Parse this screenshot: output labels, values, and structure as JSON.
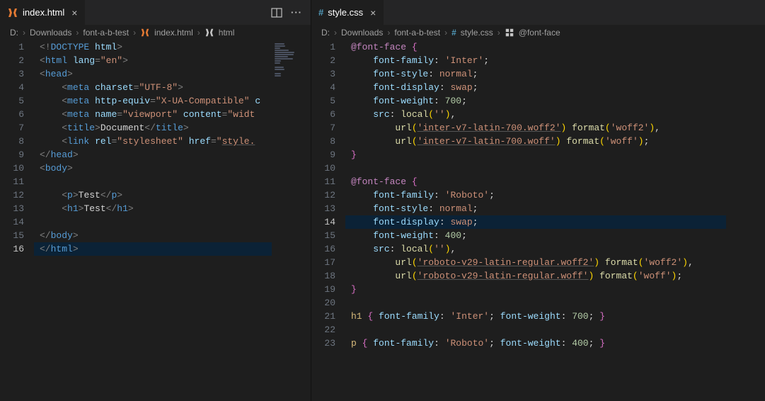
{
  "left": {
    "tab": {
      "label": "index.html"
    },
    "breadcrumbs": [
      "D:",
      "Downloads",
      "font-a-b-test",
      "index.html",
      "html"
    ],
    "lines": [
      {
        "n": 1,
        "html": "<span class='pun'>&lt;!</span><span class='tag'>DOCTYPE</span> <span class='attr'>html</span><span class='pun'>&gt;</span>"
      },
      {
        "n": 2,
        "html": "<span class='pun'>&lt;</span><span class='tag'>html</span> <span class='attr'>lang</span><span class='pun'>=</span><span class='str'>\"en\"</span><span class='pun'>&gt;</span>"
      },
      {
        "n": 3,
        "html": "<span class='pun'>&lt;</span><span class='tag'>head</span><span class='pun'>&gt;</span>"
      },
      {
        "n": 4,
        "html": "    <span class='pun'>&lt;</span><span class='tag'>meta</span> <span class='attr'>charset</span><span class='pun'>=</span><span class='str'>\"UTF-8\"</span><span class='pun'>&gt;</span>"
      },
      {
        "n": 5,
        "html": "    <span class='pun'>&lt;</span><span class='tag'>meta</span> <span class='attr'>http-equiv</span><span class='pun'>=</span><span class='str'>\"X-UA-Compatible\"</span> <span class='attr'>c</span>"
      },
      {
        "n": 6,
        "html": "    <span class='pun'>&lt;</span><span class='tag'>meta</span> <span class='attr'>name</span><span class='pun'>=</span><span class='str'>\"viewport\"</span> <span class='attr'>content</span><span class='pun'>=</span><span class='str'>\"widt</span>"
      },
      {
        "n": 7,
        "html": "    <span class='pun'>&lt;</span><span class='tag'>title</span><span class='pun'>&gt;</span><span class='txt'>Document</span><span class='pun'>&lt;/</span><span class='tag'>title</span><span class='pun'>&gt;</span>"
      },
      {
        "n": 8,
        "html": "    <span class='pun'>&lt;</span><span class='tag'>link</span> <span class='attr'>rel</span><span class='pun'>=</span><span class='str'>\"stylesheet\"</span> <span class='attr'>href</span><span class='pun'>=</span><span class='str'>\"</span><span class='sty'>style.</span>"
      },
      {
        "n": 9,
        "html": "<span class='pun'>&lt;/</span><span class='tag'>head</span><span class='pun'>&gt;</span>"
      },
      {
        "n": 10,
        "html": "<span class='pun'>&lt;</span><span class='tag'>body</span><span class='pun'>&gt;</span>"
      },
      {
        "n": 11,
        "html": ""
      },
      {
        "n": 12,
        "html": "    <span class='pun'>&lt;</span><span class='tag'>p</span><span class='pun'>&gt;</span><span class='txt'>Test</span><span class='pun'>&lt;/</span><span class='tag'>p</span><span class='pun'>&gt;</span>"
      },
      {
        "n": 13,
        "html": "    <span class='pun'>&lt;</span><span class='tag'>h1</span><span class='pun'>&gt;</span><span class='txt'>Test</span><span class='pun'>&lt;/</span><span class='tag'>h1</span><span class='pun'>&gt;</span>"
      },
      {
        "n": 14,
        "html": ""
      },
      {
        "n": 15,
        "html": "<span class='pun'>&lt;/</span><span class='tag'>body</span><span class='pun'>&gt;</span>"
      },
      {
        "n": 16,
        "html": "<span class='pun'>&lt;/</span><span class='tag'>html</span><span class='pun'>&gt;</span>",
        "cur": true
      }
    ]
  },
  "right": {
    "tab": {
      "label": "style.css"
    },
    "breadcrumbs": [
      "D:",
      "Downloads",
      "font-a-b-test",
      "style.css",
      "@font-face"
    ],
    "lines": [
      {
        "n": 1,
        "html": "<span class='kw'>@font-face</span> <span class='br'>{</span>"
      },
      {
        "n": 2,
        "html": "    <span class='prop'>font-family</span><span class='txt'>:</span> <span class='val'>'Inter'</span><span class='txt'>;</span>"
      },
      {
        "n": 3,
        "html": "    <span class='prop'>font-style</span><span class='txt'>:</span> <span class='val'>normal</span><span class='txt'>;</span>"
      },
      {
        "n": 4,
        "html": "    <span class='prop'>font-display</span><span class='txt'>:</span> <span class='val'>swap</span><span class='txt'>;</span>"
      },
      {
        "n": 5,
        "html": "    <span class='prop'>font-weight</span><span class='txt'>:</span> <span class='num'>700</span><span class='txt'>;</span>"
      },
      {
        "n": 6,
        "html": "    <span class='prop'>src</span><span class='txt'>:</span> <span class='fn'>local</span><span class='br2'>(</span><span class='val'>''</span><span class='br2'>)</span><span class='txt'>,</span>"
      },
      {
        "n": 7,
        "html": "        <span class='fn'>url</span><span class='br2'>(</span><span class='url'>'inter-v7-latin-700.woff2'</span><span class='br2'>)</span> <span class='fn'>format</span><span class='br2'>(</span><span class='val'>'woff2'</span><span class='br2'>)</span><span class='txt'>,</span>"
      },
      {
        "n": 8,
        "html": "        <span class='fn'>url</span><span class='br2'>(</span><span class='url'>'inter-v7-latin-700.woff'</span><span class='br2'>)</span> <span class='fn'>format</span><span class='br2'>(</span><span class='val'>'woff'</span><span class='br2'>)</span><span class='txt'>;</span>"
      },
      {
        "n": 9,
        "html": "<span class='br'>}</span>"
      },
      {
        "n": 10,
        "html": ""
      },
      {
        "n": 11,
        "html": "<span class='kw'>@font-face</span> <span class='br'>{</span>"
      },
      {
        "n": 12,
        "html": "    <span class='prop'>font-family</span><span class='txt'>:</span> <span class='val'>'Roboto'</span><span class='txt'>;</span>"
      },
      {
        "n": 13,
        "html": "    <span class='prop'>font-style</span><span class='txt'>:</span> <span class='val'>normal</span><span class='txt'>;</span>"
      },
      {
        "n": 14,
        "html": "    <span class='prop'>font-display</span><span class='txt'>:</span> <span class='val'>swap</span><span class='txt'>;</span>",
        "cur": true
      },
      {
        "n": 15,
        "html": "    <span class='prop'>font-weight</span><span class='txt'>:</span> <span class='num'>400</span><span class='txt'>;</span>"
      },
      {
        "n": 16,
        "html": "    <span class='prop'>src</span><span class='txt'>:</span> <span class='fn'>local</span><span class='br2'>(</span><span class='val'>''</span><span class='br2'>)</span><span class='txt'>,</span>"
      },
      {
        "n": 17,
        "html": "        <span class='fn'>url</span><span class='br2'>(</span><span class='url'>'roboto-v29-latin-regular.woff2'</span><span class='br2'>)</span> <span class='fn'>format</span><span class='br2'>(</span><span class='val'>'woff2'</span><span class='br2'>)</span><span class='txt'>,</span>"
      },
      {
        "n": 18,
        "html": "        <span class='fn'>url</span><span class='br2'>(</span><span class='url'>'roboto-v29-latin-regular.woff'</span><span class='br2'>)</span> <span class='fn'>format</span><span class='br2'>(</span><span class='val'>'woff'</span><span class='br2'>)</span><span class='txt'>;</span>"
      },
      {
        "n": 19,
        "html": "<span class='br'>}</span>"
      },
      {
        "n": 20,
        "html": ""
      },
      {
        "n": 21,
        "html": "<span class='sel'>h1</span> <span class='br'>{</span> <span class='prop'>font-family</span><span class='txt'>:</span> <span class='val'>'Inter'</span><span class='txt'>;</span> <span class='prop'>font-weight</span><span class='txt'>:</span> <span class='num'>700</span><span class='txt'>;</span> <span class='br'>}</span>"
      },
      {
        "n": 22,
        "html": ""
      },
      {
        "n": 23,
        "html": "<span class='sel'>p</span> <span class='br'>{</span> <span class='prop'>font-family</span><span class='txt'>:</span> <span class='val'>'Roboto'</span><span class='txt'>;</span> <span class='prop'>font-weight</span><span class='txt'>:</span> <span class='num'>400</span><span class='txt'>;</span> <span class='br'>}</span>"
      }
    ]
  }
}
